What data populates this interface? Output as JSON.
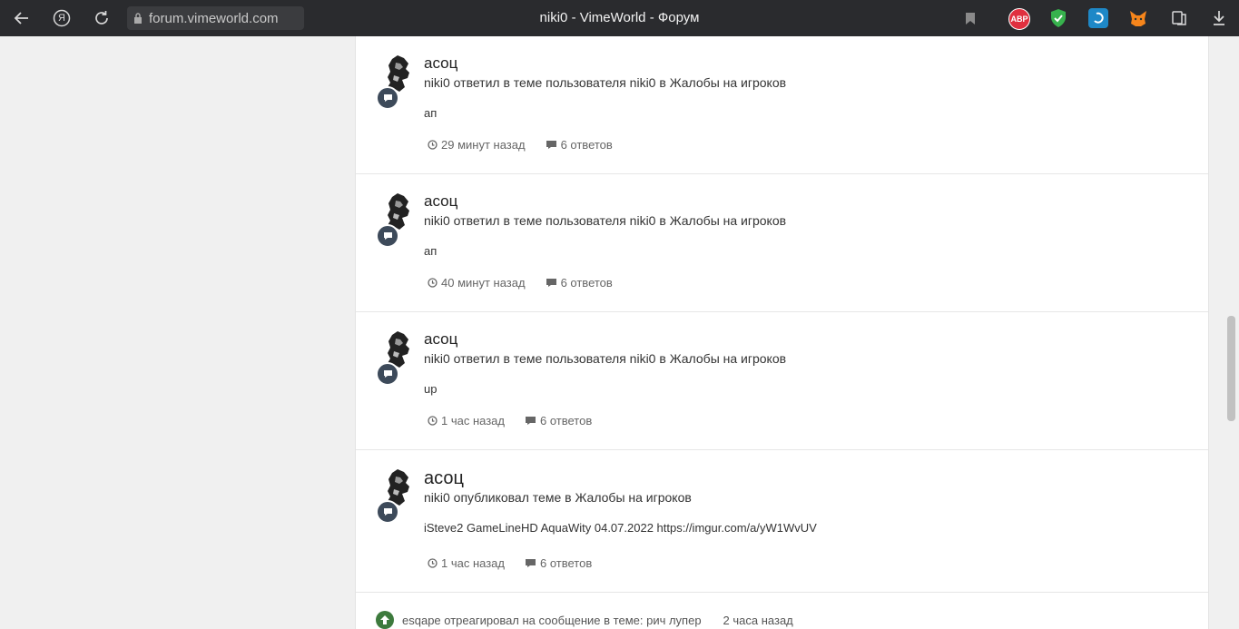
{
  "browser": {
    "url": "forum.vimeworld.com",
    "title": "niki0 - VimeWorld - Форум",
    "ya_label": "Я",
    "abp_label": "ABP",
    "colors": {
      "bar": "#2a2b2e",
      "abp": "#e0303f",
      "shield": "#37b24d",
      "ext_blue": "#1e88c7",
      "fox": "#f6851b"
    }
  },
  "feed": {
    "items": [
      {
        "title": "асоц",
        "description": "niki0 ответил в теме пользователя niki0 в Жалобы на игроков",
        "snippet": "ап",
        "time": "29 минут назад",
        "replies": "6 ответов"
      },
      {
        "title": "асоц",
        "description": "niki0 ответил в теме пользователя niki0 в Жалобы на игроков",
        "snippet": "ап",
        "time": "40 минут назад",
        "replies": "6 ответов"
      },
      {
        "title": "асоц",
        "description": "niki0 ответил в теме пользователя niki0 в Жалобы на игроков",
        "snippet": "up",
        "time": "1 час назад",
        "replies": "6 ответов"
      },
      {
        "title": "асоц",
        "description": "niki0 опубликовал теме в Жалобы на игроков",
        "snippet": "iSteve2 GameLineHD AquaWity 04.07.2022 https://imgur.com/a/yW1WvUV",
        "time": "1 час назад",
        "replies": "6 ответов"
      }
    ],
    "footer": {
      "text": "esqape отреагировал на сообщение в теме: рич лупер",
      "time": "2 часа назад"
    }
  }
}
